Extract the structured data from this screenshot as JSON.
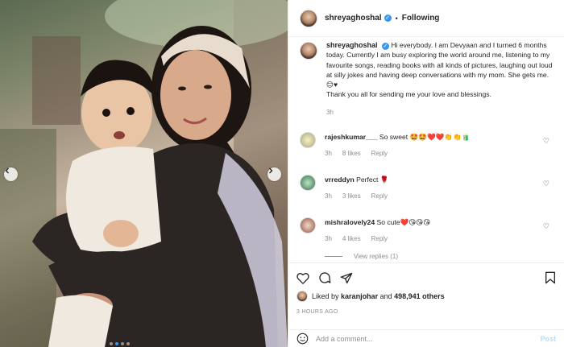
{
  "post": {
    "author": "shreyaghoshal",
    "follow_status": "Following",
    "separator": "•",
    "more": "•••",
    "caption_text": "Hi everybody. I am Devyaan and I turned 6 months today. Currently I am busy exploring the world around me, listening to my favourite songs, reading books with all kinds of pictures, laughing out loud at silly jokes and having deep conversations with my mom. She gets me. 😊♥",
    "caption_thanks": "Thank you all for sending me your love and blessings.",
    "caption_time": "3h"
  },
  "comments": [
    {
      "user": "rajeshkumar___",
      "text": "So sweet 🤩🤩❤️❤️👏👏🧃",
      "time": "3h",
      "likes": "8 likes",
      "reply": "Reply"
    },
    {
      "user": "vrreddyn",
      "text": "Perfect 🌹",
      "time": "3h",
      "likes": "3 likes",
      "reply": "Reply"
    },
    {
      "user": "mishralovely24",
      "text": "So cute❤️😘😘😘",
      "time": "3h",
      "likes": "4 likes",
      "reply": "Reply",
      "view_replies": "View replies (1)"
    }
  ],
  "likes": {
    "prefix": "Liked by",
    "user": "karanjohar",
    "and": "and",
    "count": "498,941 others"
  },
  "posted_ago": "3 HOURS AGO",
  "add_comment": {
    "placeholder": "Add a comment...",
    "post_label": "Post"
  },
  "carousel": {
    "slides": 4,
    "active": 1
  },
  "icons": [
    "heart-icon",
    "comment-icon",
    "share-icon",
    "bookmark-icon",
    "emoji-icon",
    "chevron-left-icon",
    "chevron-right-icon",
    "verified-icon"
  ],
  "colors": {
    "accent": "#3897f0",
    "muted": "#8e8e8e",
    "post_disabled": "#b2dffc"
  }
}
